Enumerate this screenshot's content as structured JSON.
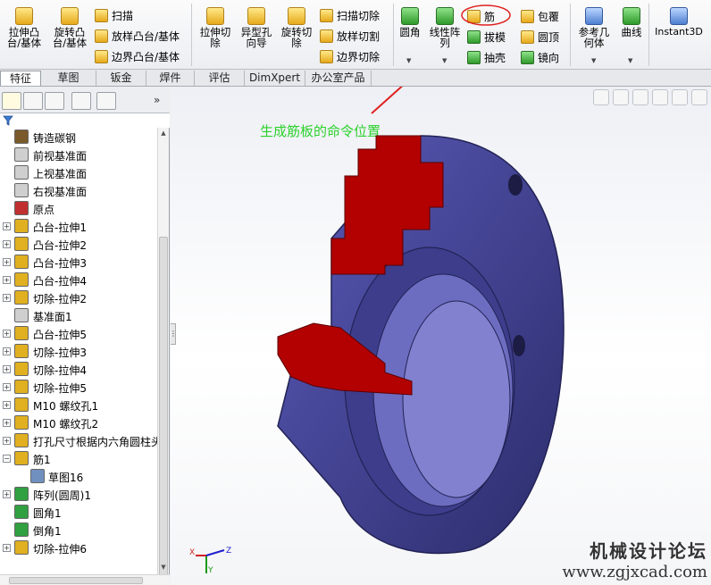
{
  "ribbon": {
    "extrude_boss": "拉伸凸\n台/基体",
    "revolve_boss": "旋转凸\n台/基体",
    "sweep": "扫描",
    "loft_boss": "放样凸台/基体",
    "boundary_boss": "边界凸台/基体",
    "extrude_cut": "拉伸切\n除",
    "hole_wizard": "异型孔\n向导",
    "revolve_cut": "旋转切\n除",
    "sweep_cut": "扫描切除",
    "loft_cut": "放样切割",
    "boundary_cut": "边界切除",
    "fillet": "圆角",
    "linear_pattern": "线性阵\n列",
    "rib": "筋",
    "draft": "拔模",
    "shell": "抽壳",
    "wrap": "包覆",
    "dome": "圆顶",
    "mirror": "镜向",
    "ref_geometry": "参考几\n何体",
    "curves": "曲线",
    "instant3d": "Instant3D"
  },
  "tabs": [
    "特征",
    "草图",
    "钣金",
    "焊件",
    "评估",
    "DimXpert",
    "办公室产品"
  ],
  "tree": [
    {
      "label": "铸造碳钢",
      "icon": "material-icon",
      "expand": false
    },
    {
      "label": "前视基准面",
      "icon": "plane-icon",
      "expand": false
    },
    {
      "label": "上视基准面",
      "icon": "plane-icon",
      "expand": false
    },
    {
      "label": "右视基准面",
      "icon": "plane-icon",
      "expand": false
    },
    {
      "label": "原点",
      "icon": "origin-icon",
      "expand": false
    },
    {
      "label": "凸台-拉伸1",
      "icon": "extrude-boss-icon",
      "expand": true
    },
    {
      "label": "凸台-拉伸2",
      "icon": "extrude-boss-icon",
      "expand": true
    },
    {
      "label": "凸台-拉伸3",
      "icon": "extrude-boss-icon",
      "expand": true
    },
    {
      "label": "凸台-拉伸4",
      "icon": "extrude-boss-icon",
      "expand": true
    },
    {
      "label": "切除-拉伸2",
      "icon": "extrude-cut-icon",
      "expand": true
    },
    {
      "label": "基准面1",
      "icon": "plane-icon",
      "expand": false
    },
    {
      "label": "凸台-拉伸5",
      "icon": "extrude-boss-icon",
      "expand": true
    },
    {
      "label": "切除-拉伸3",
      "icon": "extrude-cut-icon",
      "expand": true
    },
    {
      "label": "切除-拉伸4",
      "icon": "extrude-cut-icon",
      "expand": true
    },
    {
      "label": "切除-拉伸5",
      "icon": "extrude-cut-icon",
      "expand": true
    },
    {
      "label": "M10 螺纹孔1",
      "icon": "hole-icon",
      "expand": true
    },
    {
      "label": "M10 螺纹孔2",
      "icon": "hole-icon",
      "expand": true
    },
    {
      "label": "打孔尺寸根据内六角圆柱头",
      "icon": "hole-icon",
      "expand": true
    },
    {
      "label": "筋1",
      "icon": "rib-icon",
      "expand": "minus"
    },
    {
      "label": "草图16",
      "icon": "sketch-icon",
      "expand": false,
      "indent": true
    },
    {
      "label": "阵列(圆周)1",
      "icon": "circular-pattern-icon",
      "expand": true
    },
    {
      "label": "圆角1",
      "icon": "fillet-icon",
      "expand": false
    },
    {
      "label": "倒角1",
      "icon": "chamfer-icon",
      "expand": false
    },
    {
      "label": "切除-拉伸6",
      "icon": "extrude-cut-icon",
      "expand": true
    }
  ],
  "annotation": "生成筋板的命令位置",
  "watermark": {
    "title": "机械设计论坛",
    "url": "www.zgjxcad.com"
  },
  "triad": {
    "x": "X",
    "y": "Y",
    "z": "Z"
  },
  "colors": {
    "section": "#b30000",
    "body": "#4a4aa0",
    "annotation": "#2bd12b",
    "arrow": "#e02020"
  }
}
